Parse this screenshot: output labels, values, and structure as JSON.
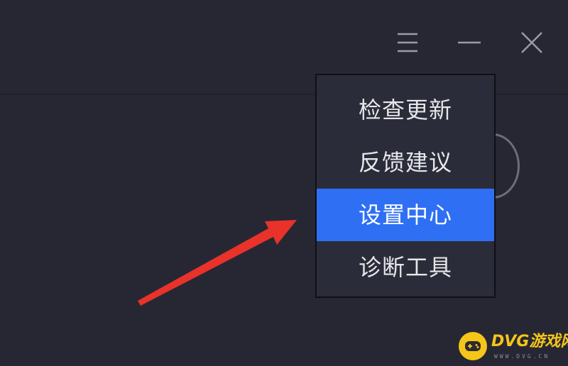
{
  "window_controls": {
    "menu_icon": "hamburger-icon",
    "minimize_icon": "minimize-icon",
    "close_icon": "close-icon"
  },
  "dropdown": {
    "items": [
      {
        "label": "检查更新",
        "active": false
      },
      {
        "label": "反馈建议",
        "active": false
      },
      {
        "label": "设置中心",
        "active": true
      },
      {
        "label": "诊断工具",
        "active": false
      }
    ]
  },
  "watermark": {
    "text": "DVG游戏网",
    "subtext": "WWW.DVG.CN",
    "icon": "gamepad-icon"
  },
  "colors": {
    "background": "#262733",
    "menu_background": "#2b2c39",
    "active_item": "#2f6ff4",
    "arrow": "#e8322a",
    "watermark": "#f5c518"
  }
}
